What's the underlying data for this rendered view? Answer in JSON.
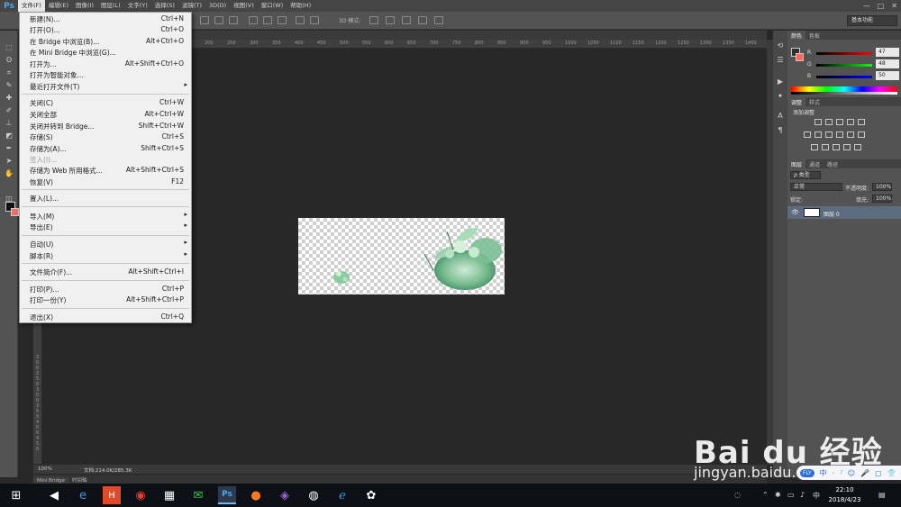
{
  "app": {
    "logo": "Ps"
  },
  "menubar": {
    "items": [
      "文件(F)",
      "编辑(E)",
      "图像(I)",
      "图层(L)",
      "文字(Y)",
      "选择(S)",
      "滤镜(T)",
      "3D(D)",
      "视图(V)",
      "窗口(W)",
      "帮助(H)"
    ],
    "window_controls": [
      "—",
      "□",
      "✕"
    ]
  },
  "optionsbar": {
    "mode_3d": "3D 模式:",
    "workspace": "基本功能"
  },
  "file_menu": {
    "items": [
      {
        "label": "新建(N)...",
        "shortcut": "Ctrl+N"
      },
      {
        "label": "打开(O)...",
        "shortcut": "Ctrl+O"
      },
      {
        "label": "在 Bridge 中浏览(B)...",
        "shortcut": "Alt+Ctrl+O"
      },
      {
        "label": "在 Mini Bridge 中浏览(G)...",
        "shortcut": ""
      },
      {
        "label": "打开为...",
        "shortcut": "Alt+Shift+Ctrl+O"
      },
      {
        "label": "打开为智能对象...",
        "shortcut": ""
      },
      {
        "label": "最近打开文件(T)",
        "shortcut": "",
        "submenu": true
      },
      {
        "label": "关闭(C)",
        "shortcut": "Ctrl+W"
      },
      {
        "label": "关闭全部",
        "shortcut": "Alt+Ctrl+W"
      },
      {
        "label": "关闭并转到 Bridge...",
        "shortcut": "Shift+Ctrl+W"
      },
      {
        "label": "存储(S)",
        "shortcut": "Ctrl+S"
      },
      {
        "label": "存储为(A)...",
        "shortcut": "Shift+Ctrl+S"
      },
      {
        "label": "签入(I)...",
        "shortcut": "",
        "disabled": true
      },
      {
        "label": "存储为 Web 所用格式...",
        "shortcut": "Alt+Shift+Ctrl+S"
      },
      {
        "label": "恢复(V)",
        "shortcut": "F12"
      },
      {
        "label": "置入(L)...",
        "shortcut": ""
      },
      {
        "label": "导入(M)",
        "shortcut": "",
        "submenu": true
      },
      {
        "label": "导出(E)",
        "shortcut": "",
        "submenu": true
      },
      {
        "label": "自动(U)",
        "shortcut": "",
        "submenu": true
      },
      {
        "label": "脚本(R)",
        "shortcut": "",
        "submenu": true
      },
      {
        "label": "文件简介(F)...",
        "shortcut": "Alt+Shift+Ctrl+I"
      },
      {
        "label": "打印(P)...",
        "shortcut": "Ctrl+P"
      },
      {
        "label": "打印一份(Y)",
        "shortcut": "Alt+Shift+Ctrl+P"
      },
      {
        "label": "退出(X)",
        "shortcut": "Ctrl+Q"
      }
    ]
  },
  "ruler": {
    "top_ticks": [
      "200",
      "250",
      "300",
      "350",
      "400",
      "450",
      "500",
      "550",
      "600",
      "650",
      "700",
      "750",
      "800",
      "850",
      "900",
      "950",
      "1000",
      "1050",
      "1100",
      "1150",
      "1200",
      "1250",
      "1300",
      "1350",
      "1400",
      "1450"
    ],
    "left_ticks": [
      "3",
      "0",
      "0",
      "2",
      "5",
      "0",
      "3",
      "0",
      "0",
      "3",
      "5",
      "0",
      "4",
      "0",
      "0",
      "4",
      "5",
      "0"
    ]
  },
  "status": {
    "zoom": "100%",
    "doc_info": "文档:214.0K/285.3K"
  },
  "bottom_tabs": [
    "Mini Bridge",
    "时间轴"
  ],
  "color_panel": {
    "tabs": [
      "颜色",
      "色板"
    ],
    "r_label": "R",
    "r_value": "47",
    "g_label": "G",
    "g_value": "48",
    "b_label": "B",
    "b_value": "50"
  },
  "adjust_panel": {
    "tabs": [
      "调整",
      "样式"
    ],
    "add_label": "添加调整"
  },
  "layers_panel": {
    "tabs": [
      "图层",
      "通道",
      "路径"
    ],
    "kind": "ρ 类型",
    "blend_mode": "正常",
    "opacity_label": "不透明度:",
    "opacity_value": "100%",
    "lock_label": "锁定:",
    "fill_label": "填充:",
    "fill_value": "100%",
    "layer_name": "图层 0"
  },
  "taskbar": {
    "time": "22:10",
    "date": "2018/4/23",
    "ime": "FLY",
    "ime_labels": [
      "中",
      "·",
      "·̕",
      "☺",
      "🎤",
      "▢",
      "👕",
      "⚙"
    ]
  },
  "watermark": {
    "brand": "Bai du 经验",
    "url": "jingyan.baidu.com"
  }
}
